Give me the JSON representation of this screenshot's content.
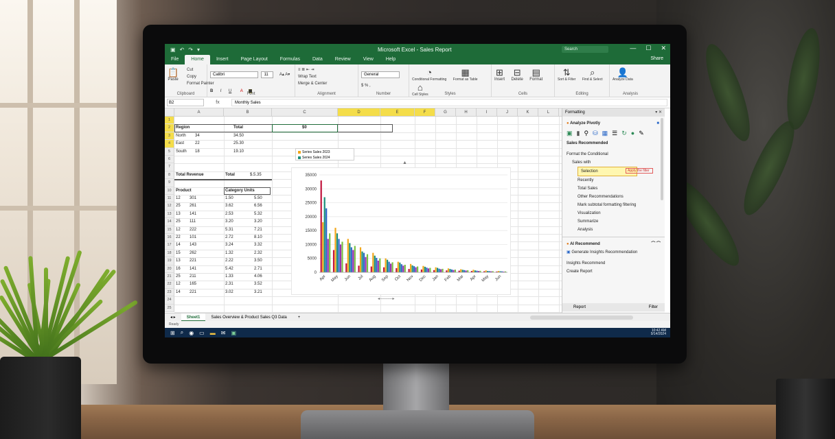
{
  "window": {
    "title": "Microsoft Excel - Sales Report",
    "search_placeholder": "Search",
    "controls": [
      "—",
      "☐",
      "✕"
    ],
    "share_label": "Share"
  },
  "ribbon": {
    "tabs": [
      "File",
      "Home",
      "Insert",
      "Page Layout",
      "Formulas",
      "Data",
      "Review",
      "View",
      "Help"
    ],
    "active_tab": "Home",
    "groups": [
      {
        "label": "Clipboard",
        "buttons": [
          "Paste"
        ],
        "small": [
          "Cut",
          "Copy",
          "Format Painter"
        ]
      },
      {
        "label": "Font",
        "font": "Calibri",
        "size": "11",
        "small": [
          "B",
          "I",
          "U"
        ]
      },
      {
        "label": "Alignment",
        "small": [
          "Wrap Text",
          "Merge & Center"
        ]
      },
      {
        "label": "Number",
        "small": [
          "General",
          "$ % ,"
        ]
      },
      {
        "label": "Styles",
        "buttons": [
          "Conditional Formatting",
          "Format as Table",
          "Cell Styles"
        ]
      },
      {
        "label": "Cells",
        "buttons": [
          "Insert",
          "Delete",
          "Format"
        ]
      },
      {
        "label": "Editing",
        "buttons": [
          "Sort & Filter",
          "Find & Select"
        ]
      },
      {
        "label": "Analysis",
        "buttons": [
          "Analyze Data"
        ]
      }
    ]
  },
  "formula_bar": {
    "name_box": "B2",
    "fx": "fx",
    "content": "Monthly Sales"
  },
  "grid": {
    "columns": [
      "A",
      "B",
      "C",
      "D",
      "E",
      "F",
      "G",
      "H",
      "I",
      "J",
      "K",
      "L",
      "M",
      "N",
      "O",
      "P"
    ],
    "rows": [
      "1",
      "2",
      "3",
      "4",
      "5",
      "6",
      "7",
      "8",
      "9",
      "10",
      "11",
      "12",
      "13",
      "14",
      "15",
      "16",
      "17",
      "18",
      "19",
      "20",
      "21",
      "22",
      "23",
      "24",
      "25"
    ],
    "top_block": [
      [
        "Region",
        "",
        "Total",
        "$0"
      ],
      [
        "North",
        "34",
        "34.50",
        ""
      ],
      [
        "East",
        "22",
        "25.30",
        ""
      ],
      [
        "South",
        "18",
        "19.10",
        ""
      ]
    ],
    "summary_row": [
      "Total Revenue",
      "Total",
      "$.5.35"
    ],
    "table_header": [
      "Product",
      "Category Units"
    ],
    "table_rows": [
      [
        "12",
        "301",
        "1.50",
        "5.50"
      ],
      [
        "25",
        "261",
        "3.62",
        "6.56"
      ],
      [
        "13",
        "141",
        "2.53",
        "5.32"
      ],
      [
        "25",
        "111",
        "3.20",
        "3.20"
      ],
      [
        "12",
        "222",
        "5.31",
        "7.21"
      ],
      [
        "22",
        "101",
        "2.72",
        "8.10"
      ],
      [
        "14",
        "143",
        "3.24",
        "3.32"
      ],
      [
        "15",
        "262",
        "1.32",
        "2.32"
      ],
      [
        "13",
        "221",
        "2.22",
        "3.50"
      ],
      [
        "16",
        "141",
        "5.42",
        "2.71"
      ],
      [
        "25",
        "211",
        "1.33",
        "4.06"
      ],
      [
        "12",
        "165",
        "2.31",
        "3.52"
      ],
      [
        "14",
        "221",
        "3.02",
        "3.21"
      ]
    ]
  },
  "legend": [
    "Series Sales 2023",
    "Series Sales 2024"
  ],
  "chart_data": {
    "type": "bar",
    "title": "",
    "ylim": [
      0,
      35000
    ],
    "y_ticks": [
      "35000",
      "30000",
      "25000",
      "20000",
      "15000",
      "10000",
      "5000",
      "0"
    ],
    "categories": [
      "Apr",
      "May",
      "Jun",
      "Jul",
      "Aug",
      "Sep",
      "Oct",
      "Nov",
      "Dec",
      "Jan",
      "Feb",
      "Mar",
      "Apr",
      "May",
      "Jun"
    ],
    "series": [
      {
        "color": "#c0143c",
        "values": [
          33000,
          8000,
          3200,
          2400,
          2100,
          1800,
          1500,
          1200,
          1000,
          800,
          700,
          600,
          500,
          400,
          300
        ]
      },
      {
        "color": "#f2a71b",
        "values": [
          18000,
          16000,
          12000,
          9000,
          7000,
          5000,
          3800,
          3000,
          2300,
          1800,
          1400,
          1100,
          900,
          700,
          500
        ]
      },
      {
        "color": "#1a8f7a",
        "values": [
          27000,
          14000,
          10500,
          7500,
          6000,
          4500,
          3500,
          2500,
          2000,
          1600,
          1200,
          900,
          700,
          500,
          400
        ]
      },
      {
        "color": "#2b68c8",
        "values": [
          23000,
          12000,
          9000,
          7000,
          5200,
          3800,
          2900,
          2200,
          1700,
          1300,
          1000,
          800,
          600,
          450,
          350
        ]
      },
      {
        "color": "#9b2fae",
        "values": [
          12000,
          10000,
          8000,
          5500,
          4200,
          3100,
          2400,
          1800,
          1400,
          1100,
          850,
          650,
          500,
          380,
          280
        ]
      },
      {
        "color": "#7ac143",
        "values": [
          14000,
          11000,
          9500,
          6500,
          5000,
          3600,
          2700,
          2100,
          1600,
          1250,
          950,
          750,
          550,
          420,
          320
        ]
      }
    ]
  },
  "pane": {
    "title": "Formatting",
    "header": "Analyze Pivotly",
    "section": "Sales Recommended",
    "items": [
      "Format the Conditional",
      "Sales with",
      "Selection",
      "Recently",
      "Total Sales",
      "Other Recommendations",
      "Mark subtotal formatting filtering",
      "Visualization",
      "Summarize",
      "Analysis"
    ],
    "selected": "Selection",
    "selected_hint": "Apply the filter",
    "assistant": "AI Recommend",
    "assistant_line": "Generate Insights Recommendation",
    "assistant_sub": "Insights Recommend",
    "assistant_item": "Create Report",
    "footer": "Report",
    "footer_right": "Filter"
  },
  "sheets": {
    "tabs": [
      "Sheet1",
      "Sales Overview & Product Sales Q3 Data"
    ],
    "active": "Sheet1",
    "add": "+"
  },
  "status": {
    "text": "Ready"
  },
  "taskbar": {
    "icons": [
      "start-icon",
      "search-icon",
      "edge-icon",
      "explorer-icon",
      "folder-icon",
      "mail-icon",
      "excel-icon"
    ],
    "time": "10:42 AM",
    "date": "9/14/2024"
  },
  "colors": {
    "brand": "#1e6b38",
    "selection": "#f4dd4a",
    "taskbar": "#0f2a4a"
  }
}
